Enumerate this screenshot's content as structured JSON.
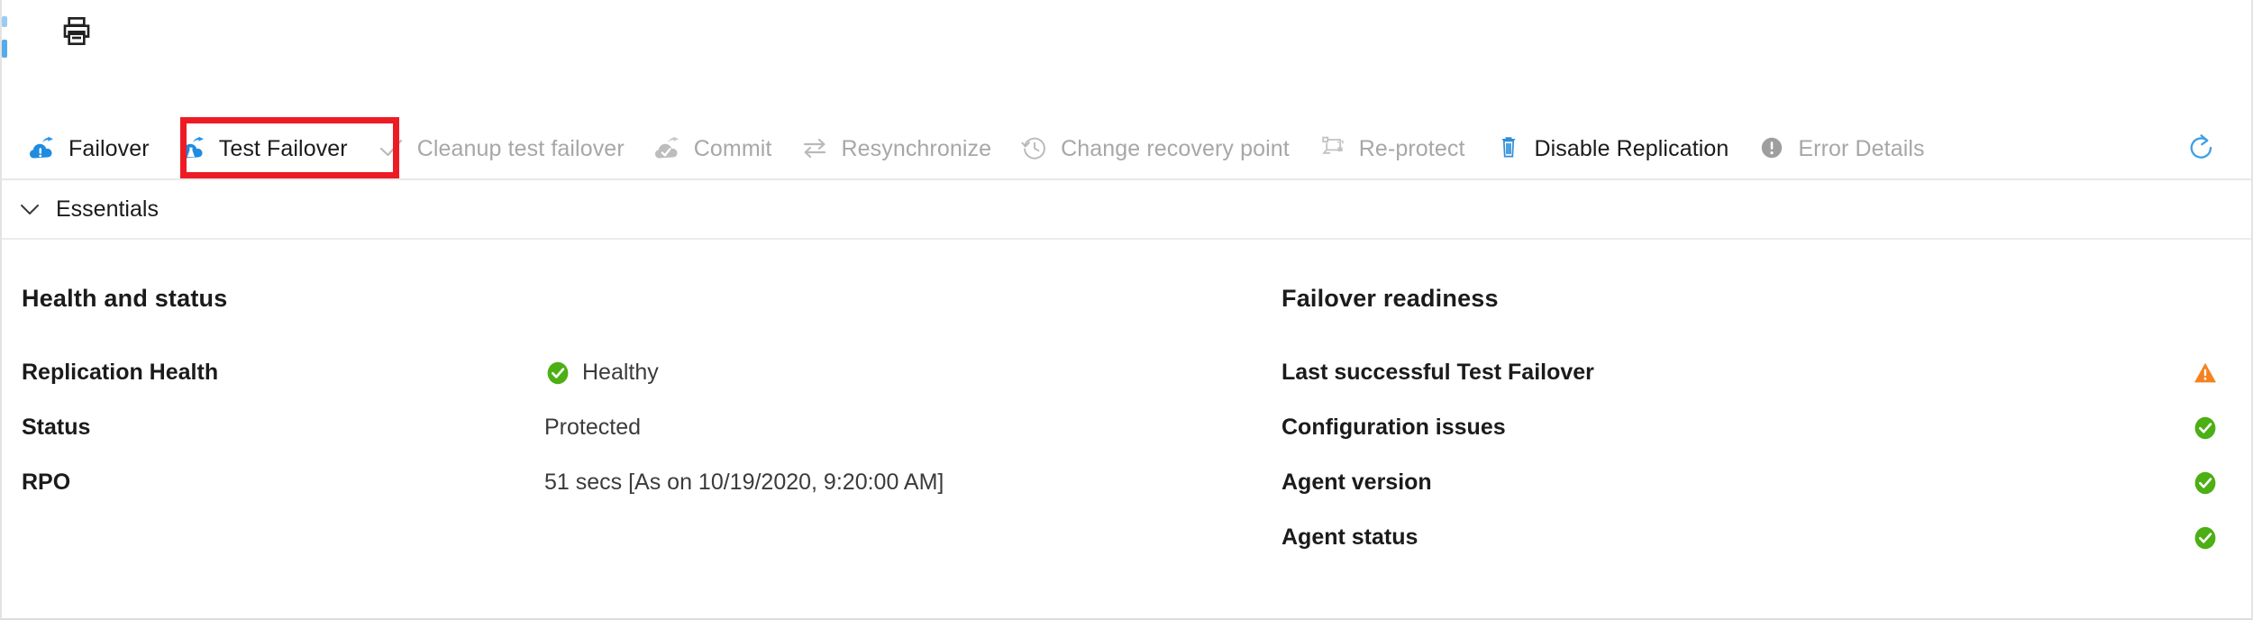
{
  "topbar": {
    "print_button": "Print",
    "print_icon": "printer-icon"
  },
  "command_bar": {
    "commands": [
      {
        "id": "failover",
        "label": "Failover",
        "icon": "failover-cloud-icon",
        "enabled": true,
        "highlighted": false
      },
      {
        "id": "test-failover",
        "label": "Test Failover",
        "icon": "test-failover-cloud-icon",
        "enabled": true,
        "highlighted": true
      },
      {
        "id": "cleanup-test-failover",
        "label": "Cleanup test failover",
        "icon": "checkmark-icon",
        "enabled": false,
        "highlighted": false
      },
      {
        "id": "commit",
        "label": "Commit",
        "icon": "commit-cloud-check-icon",
        "enabled": false,
        "highlighted": false
      },
      {
        "id": "resynchronize",
        "label": "Resynchronize",
        "icon": "two-way-arrows-icon",
        "enabled": false,
        "highlighted": false
      },
      {
        "id": "change-recovery-point",
        "label": "Change recovery point",
        "icon": "clock-history-icon",
        "enabled": false,
        "highlighted": false
      },
      {
        "id": "re-protect",
        "label": "Re-protect",
        "icon": "re-protect-icon",
        "enabled": false,
        "highlighted": false
      },
      {
        "id": "disable-replication",
        "label": "Disable Replication",
        "icon": "trash-icon",
        "enabled": true,
        "highlighted": false
      },
      {
        "id": "error-details",
        "label": "Error Details",
        "icon": "error-circle-icon",
        "enabled": false,
        "highlighted": false
      }
    ],
    "refresh": {
      "id": "refresh",
      "label": "",
      "icon": "refresh-icon",
      "enabled": true
    }
  },
  "highlight": {
    "target": "test-failover",
    "color": "#ed1c24"
  },
  "essentials": {
    "label": "Essentials",
    "chevron_icon": "chevron-down-icon",
    "expanded": true
  },
  "health_and_status": {
    "heading": "Health and status",
    "rows": [
      {
        "label": "Replication Health",
        "value": "Healthy",
        "status_icon": "green-check-icon"
      },
      {
        "label": "Status",
        "value": "Protected",
        "status_icon": ""
      },
      {
        "label": "RPO",
        "value": "51 secs [As on 10/19/2020, 9:20:00 AM]",
        "status_icon": ""
      }
    ]
  },
  "failover_readiness": {
    "heading": "Failover readiness",
    "rows": [
      {
        "label": "Last successful Test Failover",
        "status_icon": "orange-warning-icon"
      },
      {
        "label": "Configuration issues",
        "status_icon": "green-check-icon"
      },
      {
        "label": "Agent version",
        "status_icon": "green-check-icon"
      },
      {
        "label": "Agent status",
        "status_icon": "green-check-icon"
      }
    ]
  },
  "colors": {
    "accent_blue": "#0078d4",
    "icon_blue": "#1f8ce0",
    "disabled_gray": "#a7a7a7",
    "status_green": "#4caf14",
    "status_orange": "#f58220",
    "highlight_red": "#ed1c24",
    "text_dark": "#1b1b1b"
  }
}
